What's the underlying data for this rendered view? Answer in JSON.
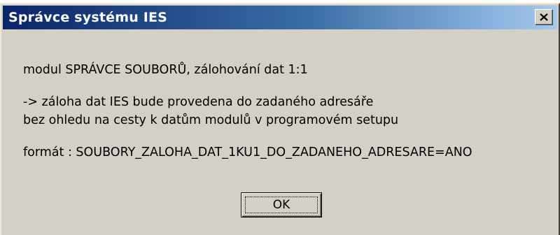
{
  "window": {
    "title": "Správce systému IES",
    "close_icon": "close-x-icon"
  },
  "message": {
    "line1": "modul SPRÁVCE SOUBORŮ, zálohování dat 1:1",
    "line2": "-> záloha dat IES bude provedena do zadaného adresáře",
    "line3": "bez ohledu na cesty k datům modulů v programovém setupu",
    "line4": "formát : SOUBORY_ZALOHA_DAT_1KU1_DO_ZADANEHO_ADRESARE=ANO"
  },
  "buttons": {
    "ok_label": "OK"
  },
  "colors": {
    "titlebar_start": "#0a246a",
    "titlebar_end": "#a6caf0",
    "dialog_bg": "#d4d0c8"
  }
}
